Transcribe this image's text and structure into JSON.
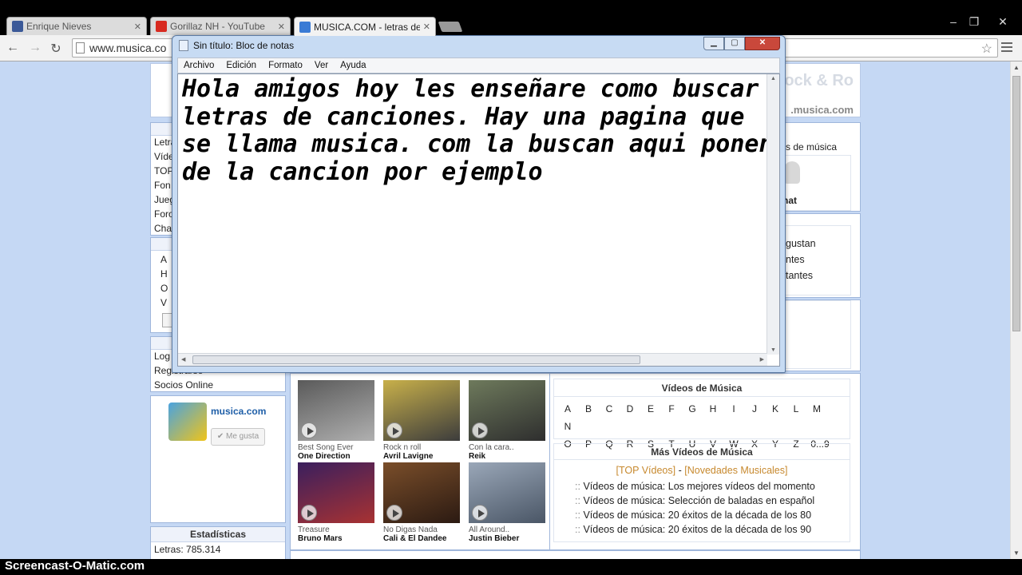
{
  "browser": {
    "tabs": [
      {
        "label": "Enrique Nieves",
        "favicon_color": "#3b5998"
      },
      {
        "label": "Gorillaz NH - YouTube",
        "favicon_color": "#d82a20"
      },
      {
        "label": "MUSICA.COM - letras de c",
        "favicon_color": "#3a7bd5"
      }
    ],
    "tab_close_glyph": "✕",
    "url": "www.musica.co",
    "back_glyph": "←",
    "forward_glyph": "→",
    "reload_glyph": "↻",
    "star_glyph": "☆",
    "window_controls": {
      "minimize": "–",
      "restore": "❐",
      "close": "✕"
    }
  },
  "site": {
    "header_text": ".musica.com",
    "header_faded": "Rock & Ro",
    "left_menu": [
      "Letra",
      "Víde",
      "TOP",
      "Fon",
      "Jueg",
      "Foro",
      "Cha"
    ],
    "left_letters": [
      "A",
      "H",
      "O",
      "V"
    ],
    "login_items": [
      "Log",
      "Registrarse",
      "Socios Online"
    ],
    "facebook_box": {
      "site": "musica.com",
      "like": "Me gusta"
    },
    "stats": {
      "title": "Estadísticas",
      "letras": "Letras: 785.314"
    },
    "right_partial": {
      "videos_label": "s de música",
      "chat_label": "hat",
      "items": [
        "gustan",
        "ntes",
        "tantes"
      ]
    },
    "videos": [
      {
        "song": "Best Song Ever",
        "artist": "One Direction",
        "colors": [
          "#5a5a5a",
          "#b0b0b0"
        ]
      },
      {
        "song": "Rock n roll",
        "artist": "Avril Lavigne",
        "colors": [
          "#c8b04a",
          "#3c3c3c"
        ]
      },
      {
        "song": "Con la cara..",
        "artist": "Reik",
        "colors": [
          "#6e7a5c",
          "#2e2e2e"
        ]
      },
      {
        "song": "Treasure",
        "artist": "Bruno Mars",
        "colors": [
          "#3a1f5e",
          "#a83232"
        ]
      },
      {
        "song": "No Digas Nada",
        "artist": "Cali & El Dandee",
        "colors": [
          "#7a4e2a",
          "#2b1a12"
        ]
      },
      {
        "song": "All Around..",
        "artist": "Justin Bieber",
        "colors": [
          "#9aa7b8",
          "#4a5666"
        ]
      }
    ],
    "videos_musica": {
      "title": "Vídeos de Música",
      "row1": [
        "A",
        "B",
        "C",
        "D",
        "E",
        "F",
        "G",
        "H",
        "I",
        "J",
        "K",
        "L",
        "M",
        "N"
      ],
      "row2": [
        "O",
        "P",
        "Q",
        "R",
        "S",
        "T",
        "U",
        "V",
        "W",
        "X",
        "Y",
        "Z",
        "0...9"
      ]
    },
    "mas_videos": {
      "title": "Más Vídeos de Música",
      "top": "[TOP Vídeos]",
      "sep": "-",
      "nov": "[Novedades Musicales]",
      "items": [
        "Vídeos de música: Los mejores vídeos del momento",
        "Vídeos de música: Selección de baladas en español",
        "Vídeos de música: 20 éxitos de la década de los 80",
        "Vídeos de música: 20 éxitos de la década de los 90"
      ],
      "bullet": "::"
    }
  },
  "notepad": {
    "title": "Sin título: Bloc de notas",
    "menu": [
      "Archivo",
      "Edición",
      "Formato",
      "Ver",
      "Ayuda"
    ],
    "text": "Hola amigos hoy les enseñare como buscar\nletras de canciones. Hay una pagina que\nse llama musica. com la buscan aqui ponen\nde la cancion por ejemplo",
    "buttons": {
      "minimize": "▁",
      "maximize": "▢",
      "close": "✕"
    }
  },
  "watermark": "Screencast-O-Matic.com",
  "colors": {
    "page_bg": "#c5d8f4",
    "link_orange": "#c7892e",
    "accent_blue": "#1f5fa8"
  }
}
